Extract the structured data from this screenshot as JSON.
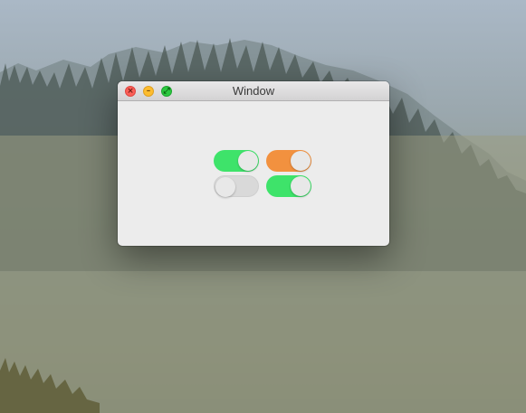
{
  "window": {
    "title": "Window",
    "controls": {
      "close_glyph": "×",
      "minimize_glyph": "–",
      "zoom_glyph": "⤢"
    }
  },
  "switches": [
    {
      "state": "on",
      "color": "#3ee36a"
    },
    {
      "state": "on",
      "color": "#f2913f"
    },
    {
      "state": "off",
      "color": "#d9d9d9"
    },
    {
      "state": "on",
      "color": "#3ee36a"
    }
  ],
  "colors": {
    "close": "#fc5f57",
    "minimize": "#fdbc2e",
    "zoom": "#2bc840",
    "window_bg": "#ececec"
  }
}
